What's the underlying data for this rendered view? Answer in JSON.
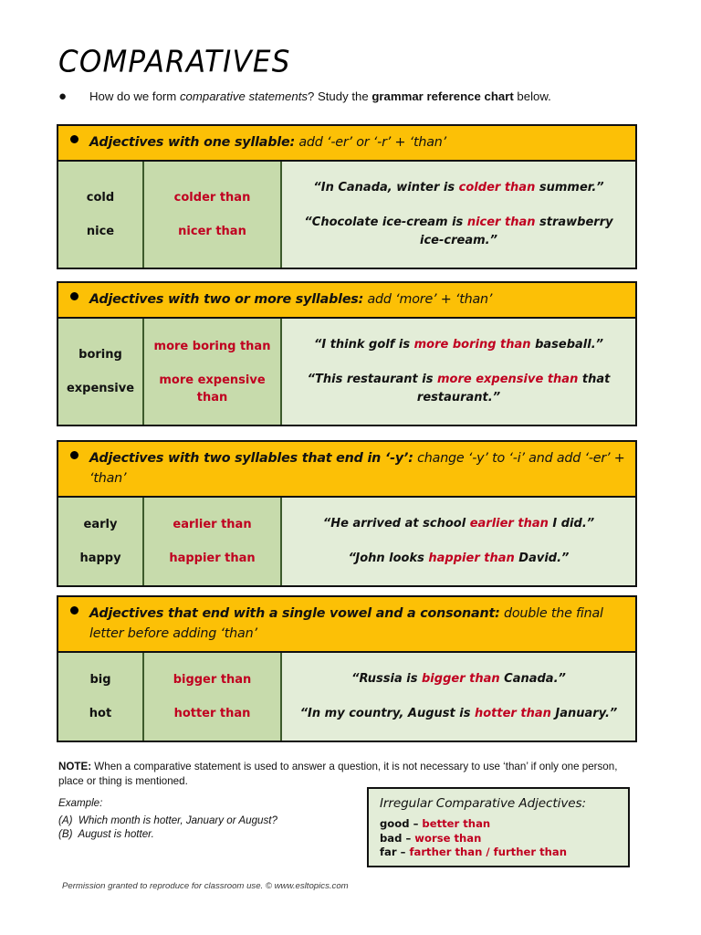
{
  "document": {
    "title": "COMPARATIVES",
    "intro": {
      "bullet": "●",
      "part1": "How do we form ",
      "emphasis1": "comparative statements",
      "part2": "?  Study the ",
      "emphasis2": "grammar reference chart",
      "part3": " below."
    }
  },
  "sections": [
    {
      "bullet": "●",
      "rule_bold": "Adjectives with one syllable:",
      "rule_rest": " add ‘-er’ or ‘-r’ + ‘than’",
      "rows": [
        {
          "adjective": "cold",
          "comparative": "colder than",
          "example_pre": "“In Canada, winter is ",
          "example_hl": "colder than",
          "example_post": " summer.”"
        },
        {
          "adjective": "nice",
          "comparative": "nicer than",
          "example_pre": "“Chocolate ice-cream is ",
          "example_hl": "nicer than",
          "example_post": " strawberry ice-cream.”"
        }
      ]
    },
    {
      "bullet": "●",
      "rule_bold": "Adjectives with two or more syllables:",
      "rule_rest": " add ‘more’ + ‘than’",
      "rows": [
        {
          "adjective": "boring",
          "comparative": "more boring than",
          "example_pre": "“I think golf is ",
          "example_hl": "more boring than",
          "example_post": " baseball.”"
        },
        {
          "adjective": "expensive",
          "comparative": "more expensive than",
          "example_pre": "“This restaurant is ",
          "example_hl": "more expensive than",
          "example_post": " that restaurant.”"
        }
      ]
    },
    {
      "bullet": "●",
      "rule_bold": "Adjectives with two syllables that end in ‘-y’:",
      "rule_rest": " change ‘-y’ to ‘-i’ and add ‘-er’ + ‘than’",
      "rows": [
        {
          "adjective": "early",
          "comparative": "earlier than",
          "example_pre": "“He arrived at school ",
          "example_hl": "earlier than",
          "example_post": " I did.”"
        },
        {
          "adjective": "happy",
          "comparative": "happier than",
          "example_pre": "“John looks ",
          "example_hl": "happier than",
          "example_post": " David.”"
        }
      ]
    },
    {
      "bullet": "●",
      "rule_bold": "Adjectives that end with a single vowel and a consonant:",
      "rule_rest": " double the final letter before adding ‘than’",
      "rows": [
        {
          "adjective": "big",
          "comparative": "bigger than",
          "example_pre": "“Russia is ",
          "example_hl": "bigger than",
          "example_post": " Canada.”"
        },
        {
          "adjective": "hot",
          "comparative": "hotter than",
          "example_pre": "“In my country, August is ",
          "example_hl": "hotter than",
          "example_post": " January.”"
        }
      ]
    }
  ],
  "note": {
    "label": "NOTE:",
    "text": " When a comparative statement is used to answer a question, it is not necessary to use ‘than’ if only one person, place or thing is mentioned."
  },
  "example_block": {
    "label": "Example:",
    "line_a": "(A)  Which month is hotter, January or August?",
    "line_b": "(B)  August is hotter."
  },
  "irregular_box": {
    "title": "Irregular Comparative Adjectives:",
    "rows": [
      {
        "base": "good – ",
        "comparative": "better than"
      },
      {
        "base": "bad – ",
        "comparative": "worse than"
      },
      {
        "base": "far – ",
        "comparative": "farther than / further than"
      }
    ]
  },
  "footer": {
    "text": "Permission granted to reproduce for classroom use.  © www.esltopics.com"
  },
  "colors": {
    "header_orange": "#FCC006",
    "cell_green_dark": "#C7DBAC",
    "cell_green_light": "#E3EDD8",
    "accent_red": "#C00020",
    "border_black": "#111111"
  }
}
